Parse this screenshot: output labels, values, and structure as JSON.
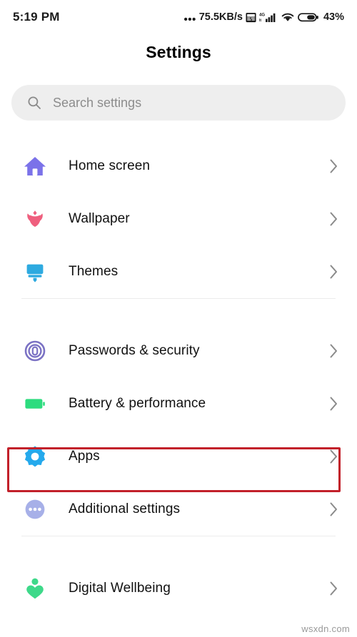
{
  "status_bar": {
    "time": "5:19 PM",
    "dots": "•••",
    "network_speed": "75.5KB/s",
    "notification_icon": "calendar-notification-icon",
    "signal_icon": "4g-signal-icon",
    "signal_label": "4G",
    "wifi_icon": "wifi-icon",
    "battery_icon": "battery-icon",
    "battery_percent": "43%"
  },
  "header": {
    "title": "Settings"
  },
  "search": {
    "icon": "search-icon",
    "placeholder": "Search settings",
    "value": ""
  },
  "colors": {
    "home": "#7b72e9",
    "wallpaper": "#ef5f7e",
    "themes": "#2eaae0",
    "security": "#7b72c4",
    "battery": "#2ddc7f",
    "apps": "#25a9ec",
    "additional": "#a7b0e8",
    "wellbeing": "#3ed98a",
    "highlight": "#c2202a",
    "chevron": "#8a8a8a",
    "search_bg": "#eeeeee",
    "divider": "#ececec"
  },
  "groups": [
    {
      "items": [
        {
          "label": "Home screen",
          "icon": "house-icon",
          "color_key": "home",
          "highlighted": false
        },
        {
          "label": "Wallpaper",
          "icon": "tulip-flower-icon",
          "color_key": "wallpaper",
          "highlighted": false
        },
        {
          "label": "Themes",
          "icon": "paint-brush-icon",
          "color_key": "themes",
          "highlighted": false
        }
      ]
    },
    {
      "items": [
        {
          "label": "Passwords & security",
          "icon": "fingerprint-icon",
          "color_key": "security",
          "highlighted": false
        },
        {
          "label": "Battery & performance",
          "icon": "battery-icon",
          "color_key": "battery",
          "highlighted": false
        },
        {
          "label": "Apps",
          "icon": "gear-icon",
          "color_key": "apps",
          "highlighted": true
        },
        {
          "label": "Additional settings",
          "icon": "three-dots-circle-icon",
          "color_key": "additional",
          "highlighted": false
        }
      ]
    },
    {
      "items": [
        {
          "label": "Digital Wellbeing",
          "icon": "person-heart-icon",
          "color_key": "wellbeing",
          "highlighted": false
        }
      ]
    }
  ],
  "watermark": {
    "text": "wsxdn.com"
  }
}
